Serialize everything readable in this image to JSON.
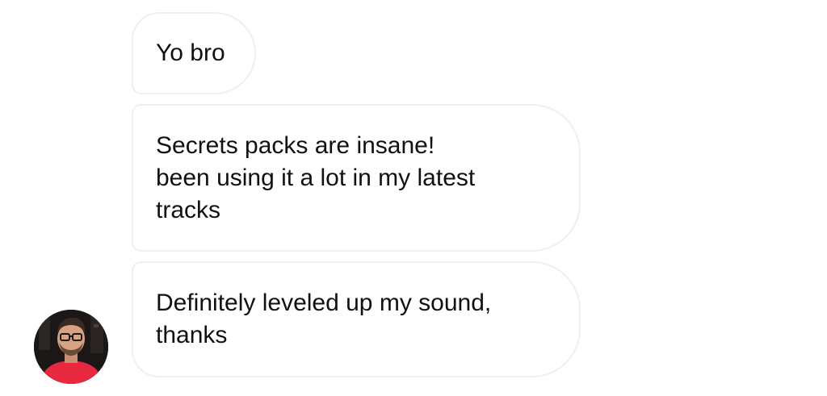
{
  "conversation": {
    "messages": [
      {
        "text": "Yo bro"
      },
      {
        "text": "Secrets packs are insane!\nbeen using it a lot in my latest\ntracks"
      },
      {
        "text": "Definitely leveled up my sound,\nthanks"
      }
    ],
    "sender": {
      "avatar_icon": "profile-photo",
      "shirt_color": "#e8283e",
      "background_color": "#1a1716"
    }
  }
}
